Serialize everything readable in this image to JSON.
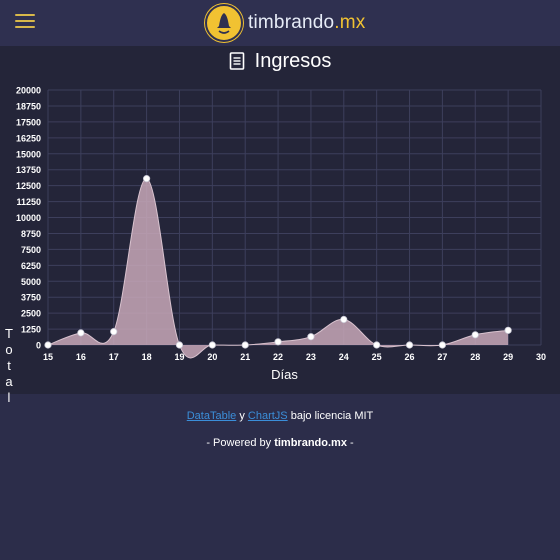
{
  "header": {
    "menu_icon": "hamburger-menu-icon",
    "brand_main": "timbrando",
    "brand_suffix": ".mx"
  },
  "section": {
    "icon": "document-icon",
    "title": "Ingresos"
  },
  "chart_data": {
    "type": "area",
    "xlabel": "Días",
    "ylabel": "Total",
    "x": [
      15,
      16,
      17,
      18,
      19,
      20,
      21,
      22,
      23,
      24,
      25,
      26,
      27,
      28,
      29
    ],
    "x_ticks": [
      "15",
      "16",
      "17",
      "18",
      "19",
      "20",
      "21",
      "22",
      "23",
      "24",
      "25",
      "26",
      "27",
      "28",
      "29",
      "30"
    ],
    "y_ticks": [
      "0",
      "1250",
      "2500",
      "3750",
      "5000",
      "6250",
      "7500",
      "8750",
      "10000",
      "11250",
      "12500",
      "13750",
      "15000",
      "16250",
      "17500",
      "18750",
      "20000"
    ],
    "series": [
      {
        "values": [
          0,
          950,
          1050,
          13050,
          0,
          0,
          0,
          250,
          650,
          2000,
          0,
          0,
          0,
          800,
          1150
        ]
      }
    ],
    "xlim": [
      15,
      30
    ],
    "ylim": [
      0,
      20000
    ],
    "grid": true,
    "colors": {
      "fill": "#c8a8b8",
      "line": "#ffffff",
      "point": "#ffffff"
    }
  },
  "footer": {
    "link1": "DataTable",
    "conj": "y",
    "link2": "ChartJS",
    "license": "bajo licencia MIT",
    "powered_prefix": "- Powered by",
    "powered_brand": "timbrando.mx",
    "powered_suffix": "-"
  }
}
